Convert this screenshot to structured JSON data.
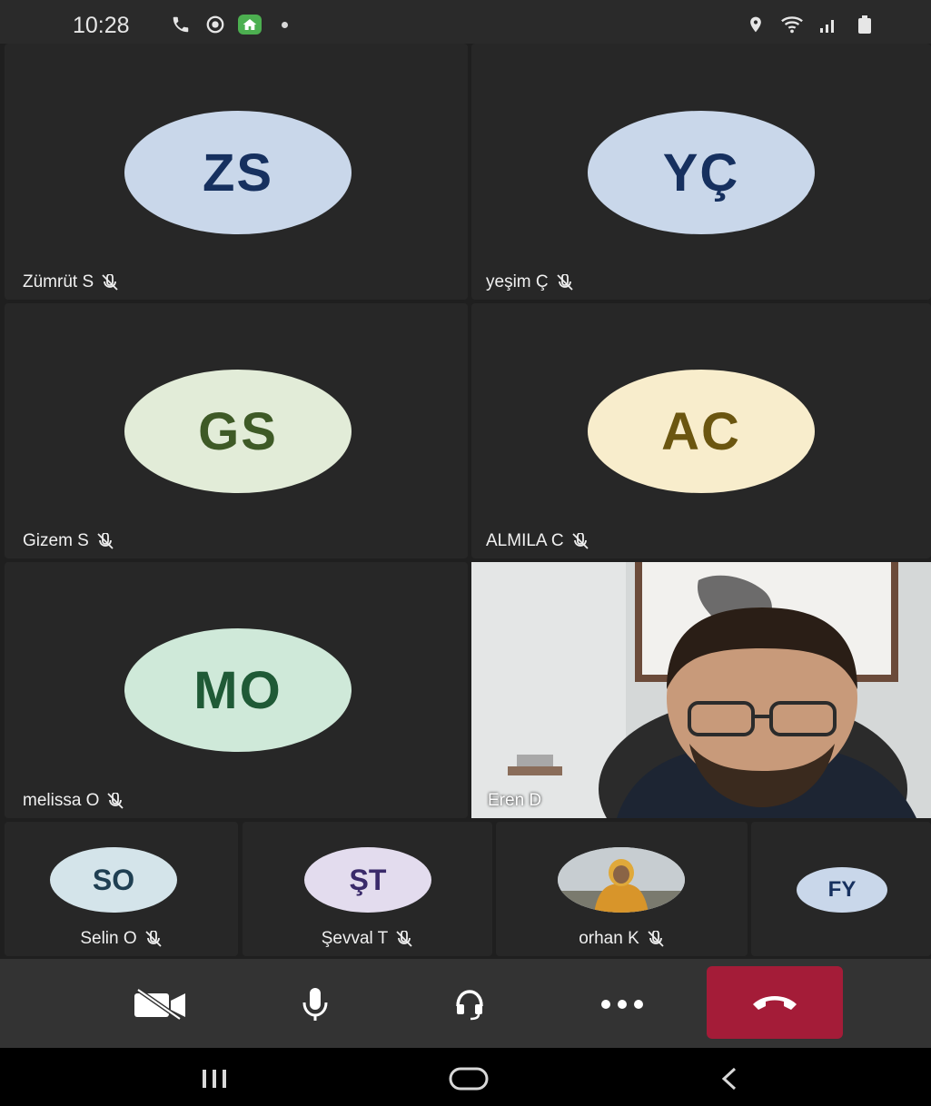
{
  "status_bar": {
    "time": "10:28",
    "left_icons": [
      "phone-icon",
      "record-icon",
      "home-icon",
      "dot"
    ],
    "right_icons": [
      "location-icon",
      "wifi-icon",
      "signal-icon",
      "battery-icon"
    ]
  },
  "participants": [
    {
      "initials": "ZS",
      "name": "Zümrüt S",
      "muted": true,
      "avatar_bg": "#c9d7ea",
      "initials_color": "#16305f"
    },
    {
      "initials": "YÇ",
      "name": "yeşim Ç",
      "muted": true,
      "avatar_bg": "#c9d7ea",
      "initials_color": "#16305f"
    },
    {
      "initials": "GS",
      "name": "Gizem S",
      "muted": true,
      "avatar_bg": "#e2ecd8",
      "initials_color": "#3e5a26"
    },
    {
      "initials": "AC",
      "name": "ALMILA C",
      "muted": true,
      "avatar_bg": "#f8edcc",
      "initials_color": "#6b5610"
    },
    {
      "initials": "MO",
      "name": "melissa O",
      "muted": true,
      "avatar_bg": "#cfe9d9",
      "initials_color": "#1f5a36"
    },
    {
      "initials": "",
      "name": "Eren D",
      "muted": false,
      "video": true
    }
  ],
  "small_participants": [
    {
      "initials": "SO",
      "name": "Selin O",
      "muted": true,
      "avatar_bg": "#d4e4ea",
      "initials_color": "#1f3f52"
    },
    {
      "initials": "ŞT",
      "name": "Şevval T",
      "muted": true,
      "avatar_bg": "#e3dcee",
      "initials_color": "#3a2a6a"
    },
    {
      "initials": "",
      "name": "orhan K",
      "muted": true,
      "photo": true
    },
    {
      "initials": "FY",
      "name": "",
      "muted": false,
      "avatar_bg": "#c9d7ea",
      "initials_color": "#16305f"
    }
  ],
  "controls": [
    "camera-off-icon",
    "microphone-icon",
    "headset-icon",
    "more-icon",
    "end-call-icon"
  ],
  "colors": {
    "end_call": "#a41c38",
    "tile_bg": "#272727",
    "control_bar": "#333333"
  },
  "nav": [
    "recent-apps-icon",
    "home-button-icon",
    "back-icon"
  ]
}
